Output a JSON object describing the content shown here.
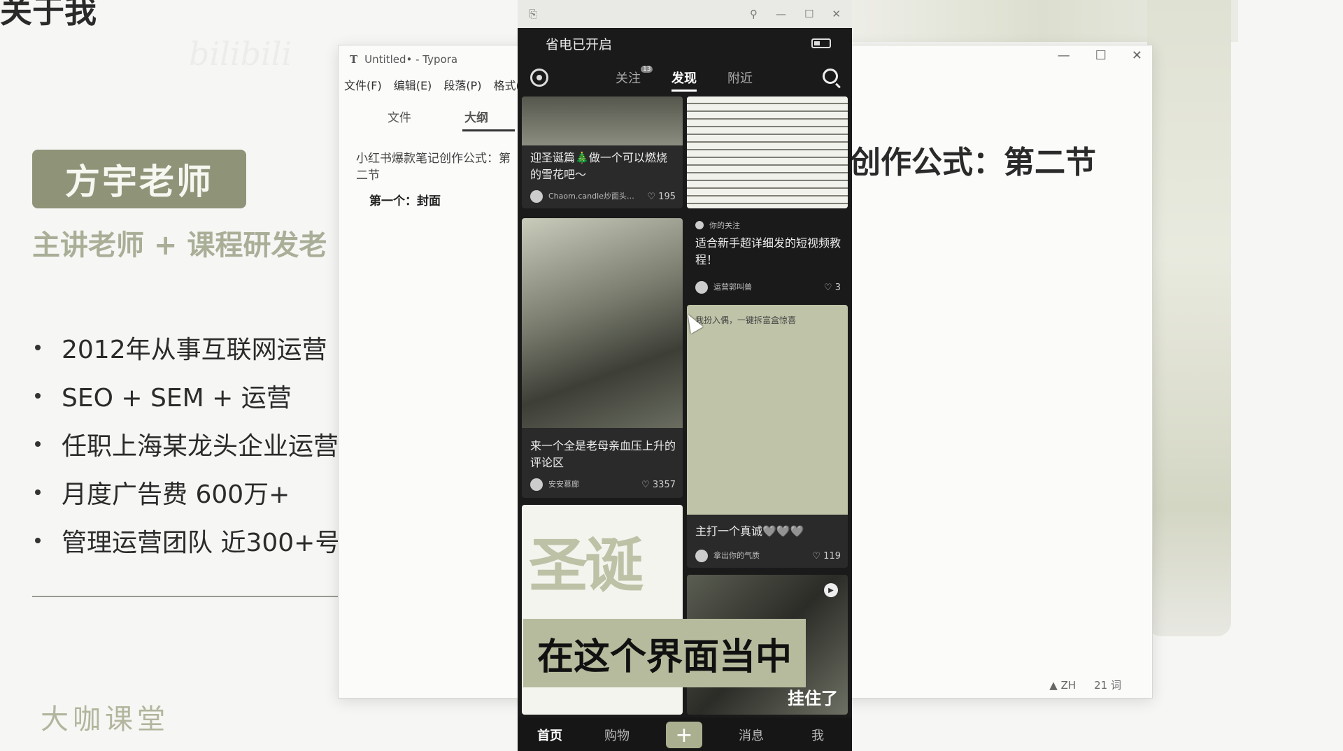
{
  "slide": {
    "title_fragment": "关于我",
    "bili_watermark": "bilibili",
    "teacher_name": "方宇老师",
    "teacher_subtitle": "主讲老师 + 课程研发老",
    "bullets": [
      "2012年从事互联网运营",
      "SEO + SEM + 运营",
      "任职上海某龙头企业运营",
      "月度广告费 600万+",
      "管理运营团队 近300+号"
    ],
    "right_title": "创作公式：第二节",
    "corner_watermark": "大咖课堂"
  },
  "typora": {
    "title": "Untitled• - Typora",
    "app_icon_letter": "T",
    "menu": [
      "文件(F)",
      "编辑(E)",
      "段落(P)",
      "格式("
    ],
    "tabs": {
      "file": "文件",
      "outline": "大纲"
    },
    "outline": {
      "heading": "小红书爆款笔记创作公式：第二节",
      "sub": "第一个：封面"
    },
    "status": {
      "lang": "ZH",
      "word_count": "21 词"
    }
  },
  "phone": {
    "power_saving": "省电已开启",
    "nav": {
      "follow": "关注",
      "follow_badge": "13",
      "discover": "发现",
      "nearby": "附近"
    },
    "cards": [
      {
        "title": "迎圣诞篇🎄做一个可以燃烧的雪花吧～",
        "author": "Chaom.candle炒面头…",
        "likes": "195"
      },
      {
        "tag": "你的关注",
        "title": "适合新手超详细发的短视频教程！",
        "author": "运营郭叫兽",
        "likes": "3"
      },
      {
        "title": "来一个全是老母亲血压上升的评论区",
        "author": "安安慕廊",
        "likes": "3357"
      },
      {
        "cover_caption": "我扮入偶，一键拆富盒惊喜",
        "title": "主打一个真诚🩶🩶🩶",
        "author": "拿出你的气质",
        "likes": "119"
      },
      {
        "cover_text": "圣诞"
      },
      {
        "overlay": "挂住了"
      }
    ],
    "tabbar": {
      "home": "首页",
      "shop": "购物",
      "plus": "+",
      "messages": "消息",
      "me": "我"
    }
  },
  "subtitle": "在这个界面当中",
  "colors": {
    "olive_accent": "#8f9479",
    "subtitle_bg": "#b6bb9d",
    "phone_bg": "#1a1a1a"
  }
}
